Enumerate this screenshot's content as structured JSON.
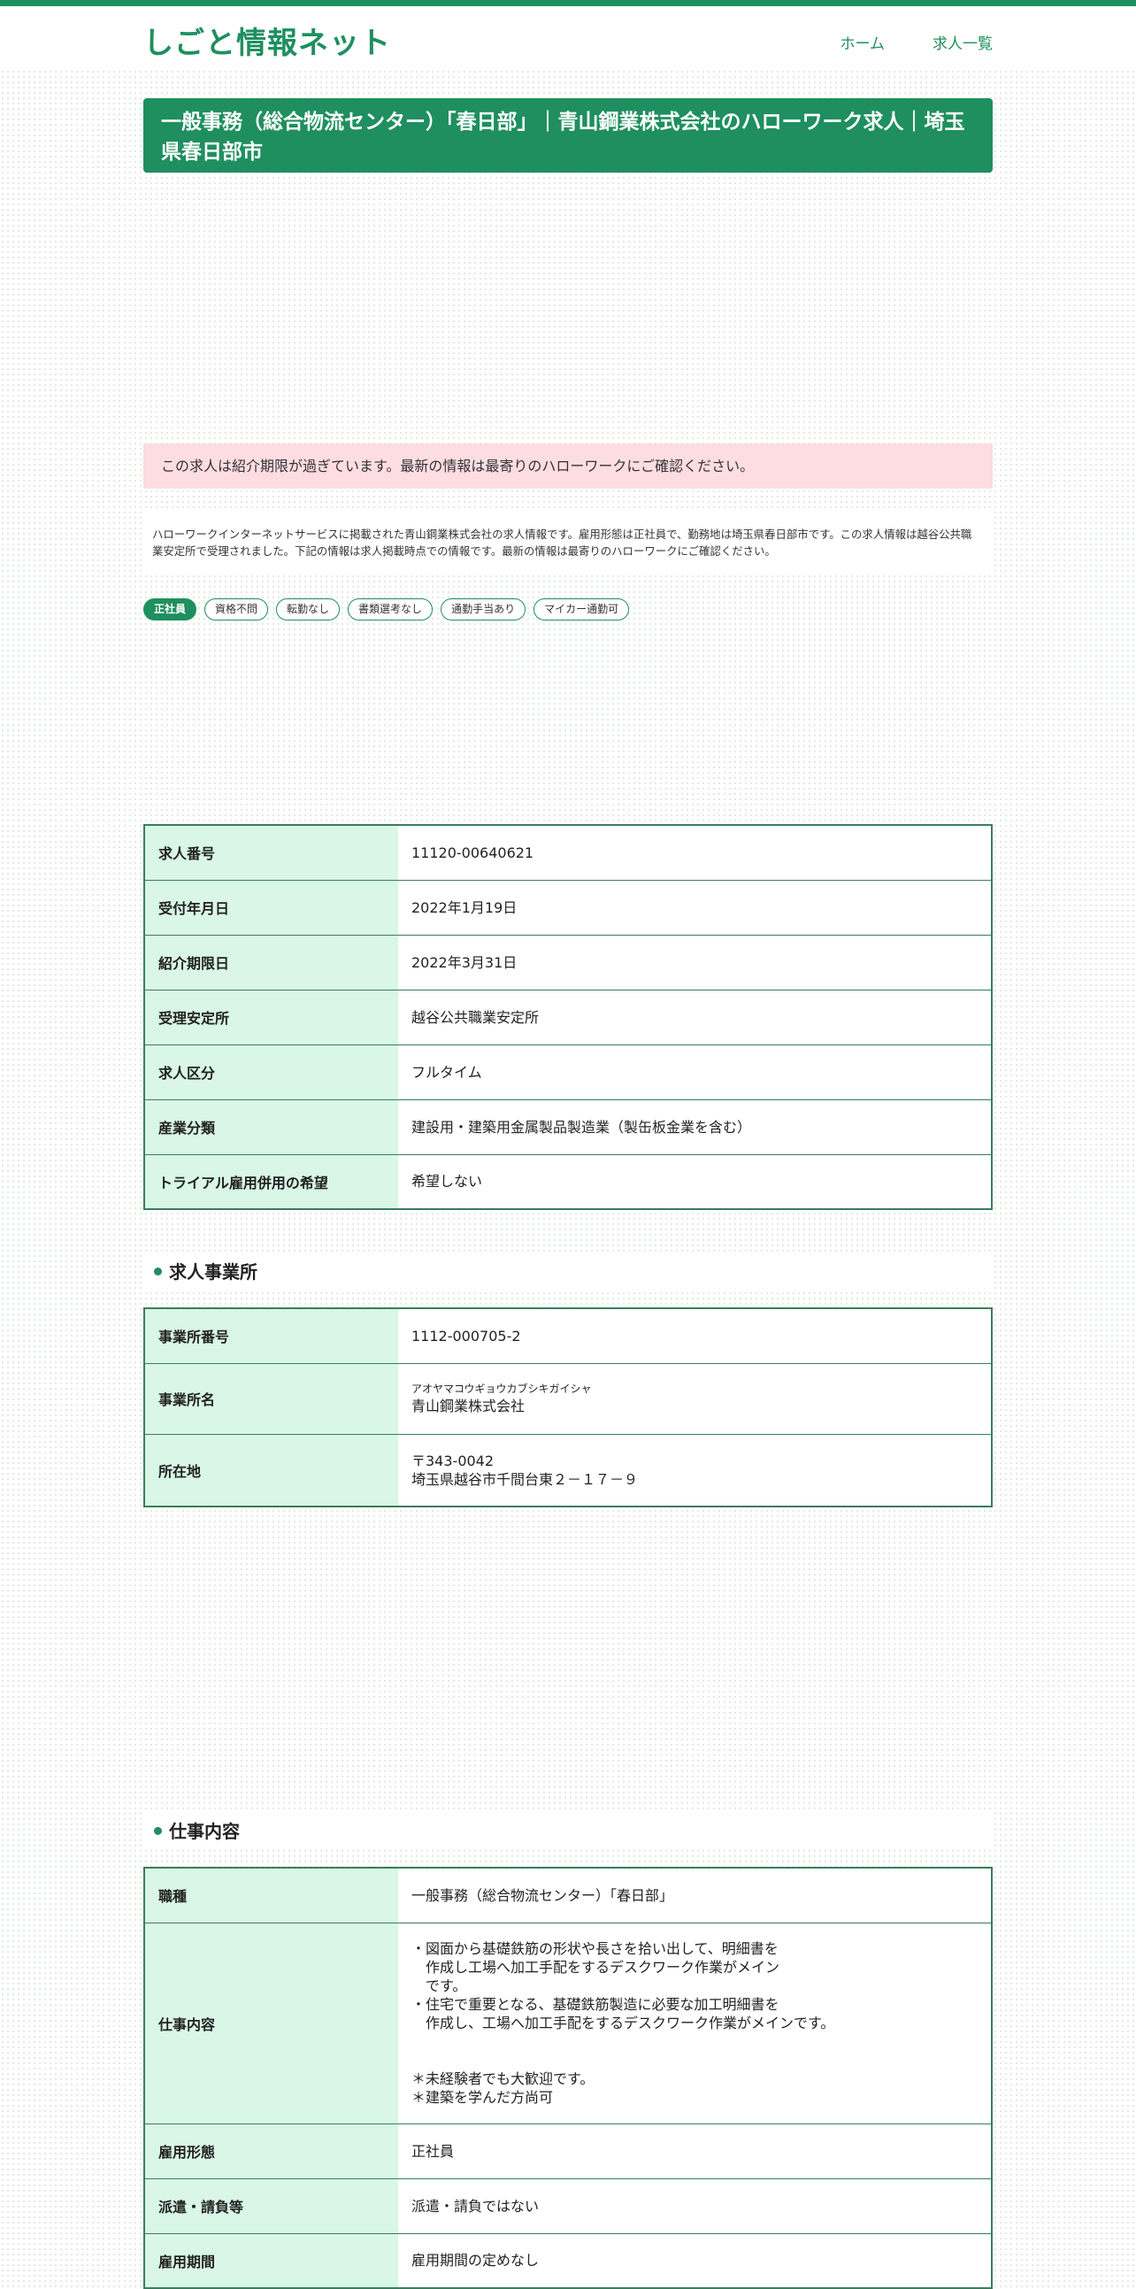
{
  "site": {
    "title": "しごと情報ネット",
    "nav": [
      "ホーム",
      "求人一覧"
    ]
  },
  "page_title": "一般事務（総合物流センター）「春日部」｜青山鋼業株式会社のハローワーク求人｜埼玉県春日部市",
  "expired_notice": "この求人は紹介期限が過ぎています。最新の情報は最寄りのハローワークにご確認ください。",
  "summary": "ハローワークインターネットサービスに掲載された青山鋼業株式会社の求人情報です。雇用形態は正社員で、勤務地は埼玉県春日部市です。この求人情報は越谷公共職業安定所で受理されました。下記の情報は求人掲載時点での情報です。最新の情報は最寄りのハローワークにご確認ください。",
  "tags": [
    {
      "label": "正社員",
      "active": true
    },
    {
      "label": "資格不問",
      "active": false
    },
    {
      "label": "転勤なし",
      "active": false
    },
    {
      "label": "書類選考なし",
      "active": false
    },
    {
      "label": "通勤手当あり",
      "active": false
    },
    {
      "label": "マイカー通勤可",
      "active": false
    }
  ],
  "basic_info": [
    {
      "label": "求人番号",
      "value": "11120-00640621"
    },
    {
      "label": "受付年月日",
      "value": "2022年1月19日"
    },
    {
      "label": "紹介期限日",
      "value": "2022年3月31日"
    },
    {
      "label": "受理安定所",
      "value": "越谷公共職業安定所"
    },
    {
      "label": "求人区分",
      "value": "フルタイム"
    },
    {
      "label": "産業分類",
      "value": "建設用・建築用金属製品製造業（製缶板金業を含む）"
    },
    {
      "label": "トライアル雇用併用の希望",
      "value": "希望しない"
    }
  ],
  "office_section": {
    "heading": "求人事業所",
    "rows": [
      {
        "label": "事業所番号",
        "value": "1112-000705-2"
      },
      {
        "label": "事業所名",
        "kana": "アオヤマコウギョウカブシキガイシャ",
        "value": "青山鋼業株式会社"
      },
      {
        "label": "所在地",
        "postal": "〒343-0042",
        "value": "埼玉県越谷市千間台東２－１７－９"
      }
    ]
  },
  "job_section": {
    "heading": "仕事内容",
    "rows": [
      {
        "label": "職種",
        "value": "一般事務（総合物流センター）「春日部」"
      },
      {
        "label": "仕事内容",
        "value": "・図面から基礎鉄筋の形状や長さを拾い出して、明細書を\n　作成し工場へ加工手配をするデスクワーク作業がメイン\n　です。\n・住宅で重要となる、基礎鉄筋製造に必要な加工明細書を\n　作成し、工場へ加工手配をするデスクワーク作業がメインです。\n\n\n＊未経験者でも大歓迎です。\n＊建築を学んだ方尚可"
      },
      {
        "label": "雇用形態",
        "value": "正社員"
      },
      {
        "label": "派遣・請負等",
        "value": "派遣・請負ではない"
      },
      {
        "label": "雇用期間",
        "value": "雇用期間の定めなし"
      }
    ]
  }
}
